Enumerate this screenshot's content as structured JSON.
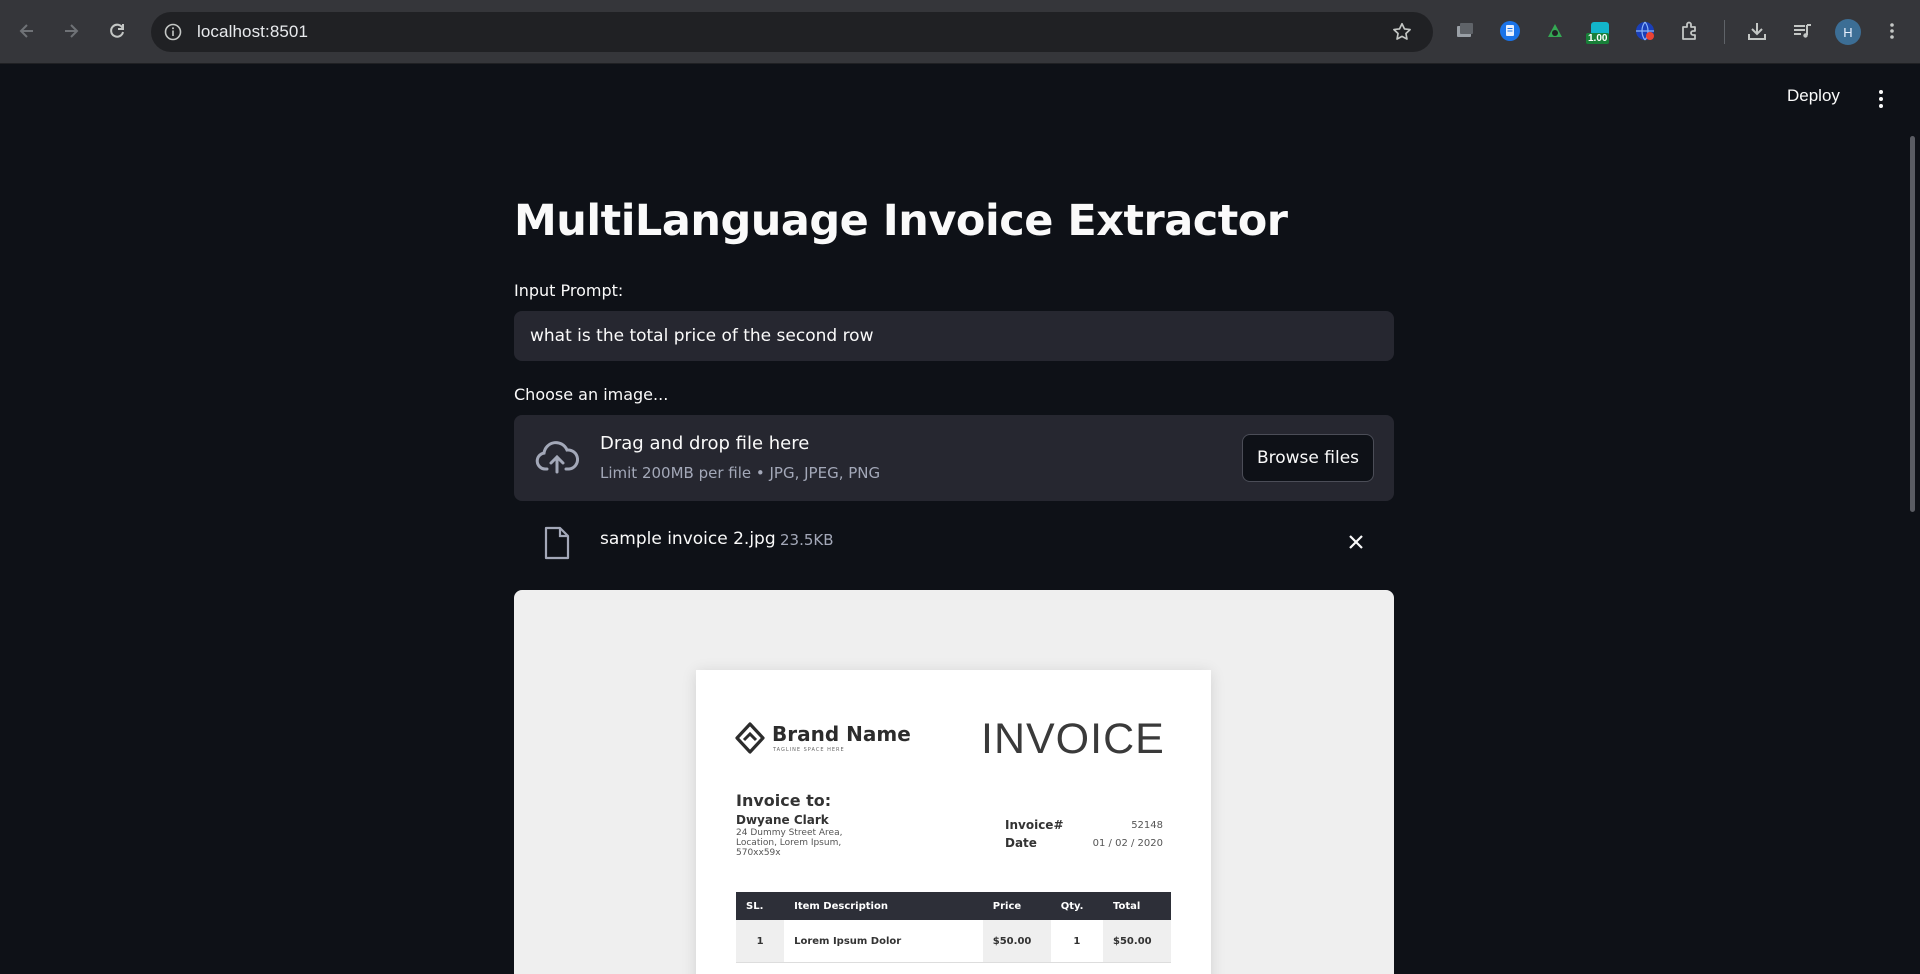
{
  "browser": {
    "url": "localhost:8501",
    "extension_badge": "1.00",
    "profile_initial": "H",
    "icons": [
      "back-arrow-icon",
      "forward-arrow-icon",
      "reload-icon",
      "site-info-icon",
      "bookmark-star-icon",
      "tab-search-icon",
      "docs-extension-icon",
      "extension-green-icon",
      "extension-counter-icon",
      "extension-globe-icon",
      "puzzle-extensions-icon",
      "download-icon",
      "media-playlist-icon",
      "chrome-menu-icon"
    ]
  },
  "app": {
    "deploy_label": "Deploy",
    "title": "MultiLanguage Invoice Extractor",
    "prompt_label": "Input Prompt:",
    "prompt_value": "what is the total price of the second row",
    "uploader_label": "Choose an image...",
    "drop_title": "Drag and drop file here",
    "drop_limit": "Limit 200MB per file • JPG, JPEG, PNG",
    "browse_label": "Browse files",
    "file_name": "sample invoice 2.jpg",
    "file_size": "23.5KB"
  },
  "invoice_image": {
    "brand_name": "Brand Name",
    "brand_tagline": "TAGLINE SPACE HERE",
    "heading": "INVOICE",
    "to_label": "Invoice to:",
    "to_name": "Dwyane Clark",
    "to_address": "24 Dummy Street Area, Location, Lorem Ipsum, 570xx59x",
    "invoice_no_label": "Invoice#",
    "invoice_no": "52148",
    "date_label": "Date",
    "date": "01 / 02 / 2020",
    "columns": [
      "SL.",
      "Item Description",
      "Price",
      "Qty.",
      "Total"
    ],
    "rows": [
      [
        "1",
        "Lorem Ipsum Dolor",
        "$50.00",
        "1",
        "$50.00"
      ]
    ]
  },
  "colors": {
    "app_background": "#0e1117",
    "input_background": "#262730",
    "browser_toolbar": "#35363a"
  }
}
